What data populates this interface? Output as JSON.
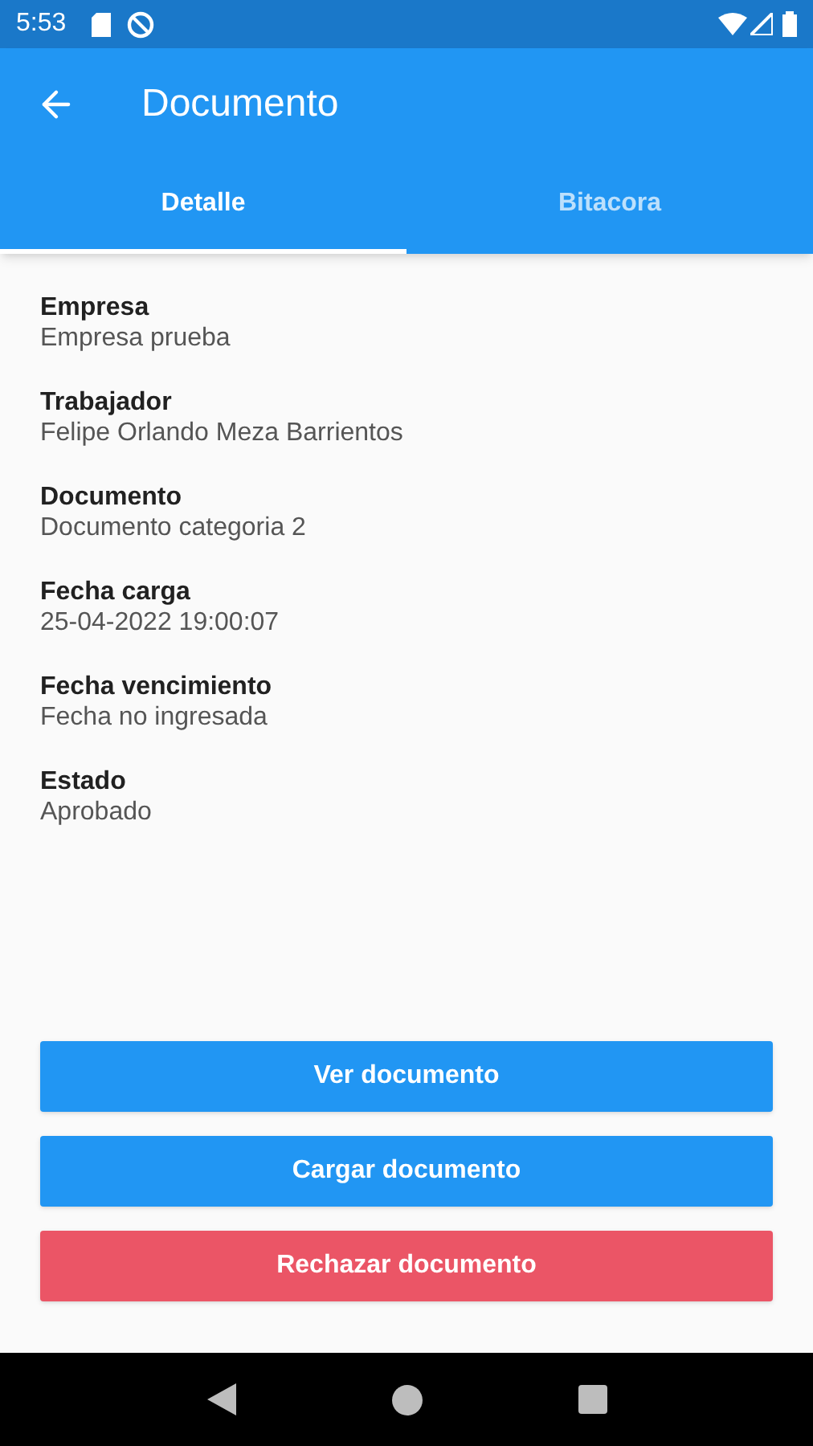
{
  "status_bar": {
    "time": "5:53"
  },
  "app_bar": {
    "title": "Documento"
  },
  "tabs": [
    {
      "label": "Detalle",
      "selected": true
    },
    {
      "label": "Bitacora",
      "selected": false
    }
  ],
  "fields": [
    {
      "label": "Empresa",
      "value": "Empresa prueba"
    },
    {
      "label": "Trabajador",
      "value": "Felipe Orlando Meza Barrientos"
    },
    {
      "label": "Documento",
      "value": "Documento categoria 2"
    },
    {
      "label": "Fecha carga",
      "value": "25-04-2022 19:00:07"
    },
    {
      "label": "Fecha vencimiento",
      "value": "Fecha no ingresada"
    },
    {
      "label": "Estado",
      "value": "Aprobado"
    }
  ],
  "buttons": [
    {
      "label": "Ver documento",
      "kind": "primary"
    },
    {
      "label": "Cargar documento",
      "kind": "primary"
    },
    {
      "label": "Rechazar documento",
      "kind": "danger"
    }
  ]
}
